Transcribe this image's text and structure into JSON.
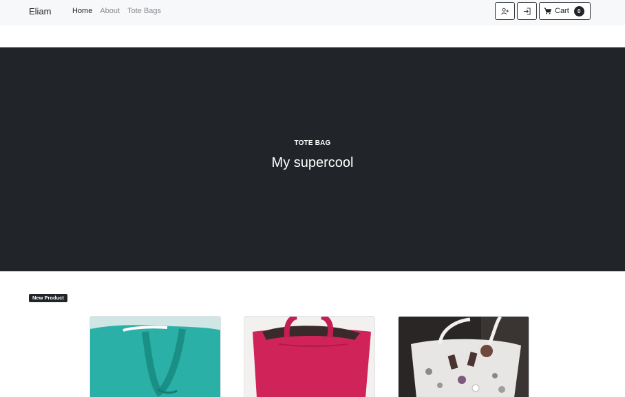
{
  "navbar": {
    "brand": "Eliam",
    "links": [
      {
        "label": "Home",
        "active": true
      },
      {
        "label": "About",
        "active": false
      },
      {
        "label": "Tote Bags",
        "active": false
      }
    ],
    "buttons": {
      "register_icon": "user-plus-icon",
      "login_icon": "sign-in-icon",
      "cart_icon": "cart-icon",
      "cart_label": "Cart",
      "cart_count": "0"
    }
  },
  "hero": {
    "eyebrow": "TOTE BAG",
    "title": "My supercool",
    "background": "#212529"
  },
  "products": {
    "badge": "New Product",
    "items": [
      {
        "name": "teal-tote-bag",
        "color": "#2ab0a7"
      },
      {
        "name": "pink-tote-bag",
        "color": "#d0235a"
      },
      {
        "name": "floral-tote-bag",
        "color": "#e8e6e4"
      }
    ]
  }
}
